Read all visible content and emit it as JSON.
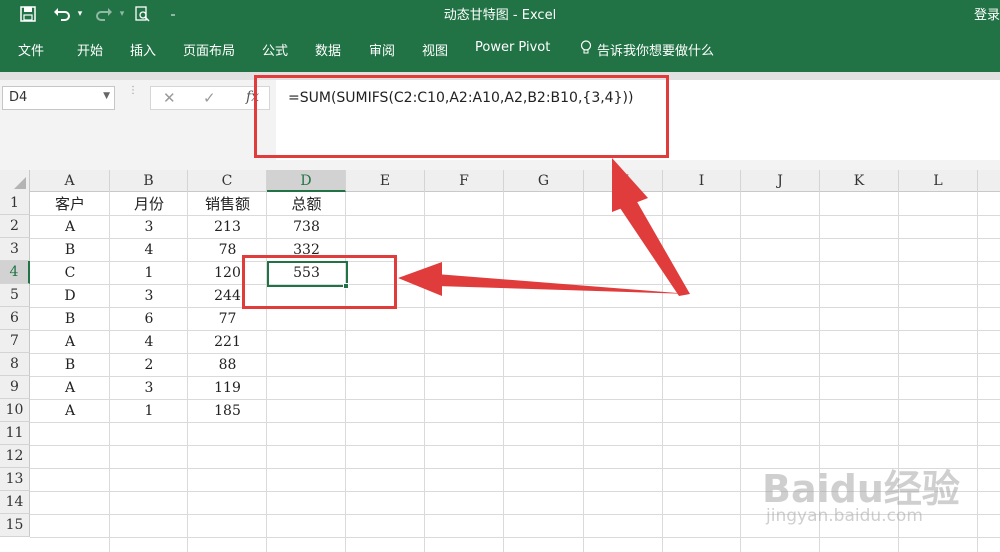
{
  "window": {
    "title": "动态甘特图 - Excel",
    "login": "登录"
  },
  "quick_access": {
    "save_icon": "floppy-disk-icon",
    "undo_icon": "undo-icon",
    "redo_icon": "redo-icon",
    "preview_icon": "print-preview-icon",
    "customize_icon": "customize-icon"
  },
  "ribbon": {
    "tabs": [
      "文件",
      "开始",
      "插入",
      "页面布局",
      "公式",
      "数据",
      "审阅",
      "视图",
      "Power Pivot"
    ],
    "tell_me": "告诉我你想要做什么"
  },
  "formula_bar": {
    "name_box": "D4",
    "fx": "fx",
    "formula": "=SUM(SUMIFS(C2:C10,A2:A10,A2,B2:B10,{3,4}))"
  },
  "sheet": {
    "columns": [
      "A",
      "B",
      "C",
      "D",
      "E",
      "F",
      "G",
      "H",
      "I",
      "J",
      "K",
      "L"
    ],
    "row_numbers": [
      "1",
      "2",
      "3",
      "4",
      "5",
      "6",
      "7",
      "8",
      "9",
      "10",
      "11",
      "12",
      "13",
      "14",
      "15"
    ],
    "active_cell": "D4",
    "headers": [
      "客户",
      "月份",
      "销售额",
      "总额"
    ],
    "rows": [
      [
        "A",
        "3",
        "213",
        "738"
      ],
      [
        "B",
        "4",
        "78",
        "332"
      ],
      [
        "C",
        "1",
        "120",
        "553"
      ],
      [
        "D",
        "3",
        "244",
        ""
      ],
      [
        "B",
        "6",
        "77",
        ""
      ],
      [
        "A",
        "4",
        "221",
        ""
      ],
      [
        "B",
        "2",
        "88",
        ""
      ],
      [
        "A",
        "3",
        "119",
        ""
      ],
      [
        "A",
        "1",
        "185",
        ""
      ]
    ]
  },
  "annotation_color": "#e03c3c",
  "accent_color": "#217346",
  "watermark": {
    "main": "Baidu经验",
    "sub": "jingyan.baidu.com"
  }
}
